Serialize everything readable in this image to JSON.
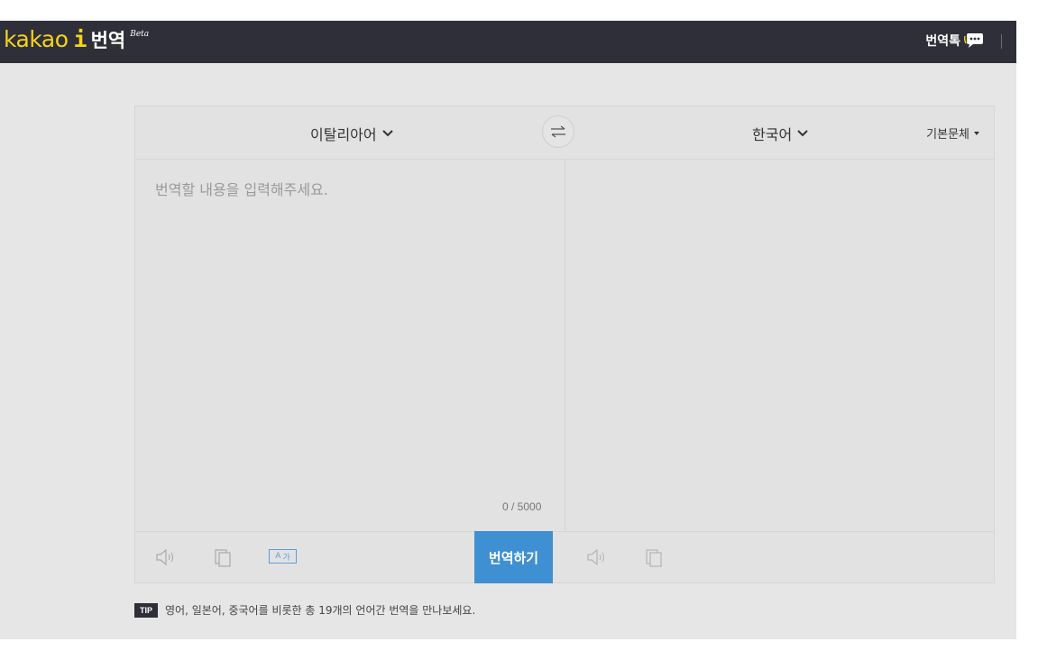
{
  "header": {
    "logo_kakao": "kakao",
    "logo_i": "i",
    "logo_title": "번역",
    "logo_beta": "Beta",
    "talk_link": "번역톡"
  },
  "translator": {
    "source_language": "이탈리아어",
    "target_language": "한국어",
    "font_option": "기본문체",
    "input_placeholder": "번역할 내용을 입력해주세요.",
    "input_value": "",
    "char_count": "0 / 5000",
    "translate_button": "번역하기",
    "ag_icon_label_a": "A",
    "ag_icon_label_ga": "가"
  },
  "tip": {
    "badge": "TIP",
    "text": "영어, 일본어, 중국어를 비롯한 총 19개의 언어간 번역을 만나보세요."
  },
  "colors": {
    "topbar": "#2e2f38",
    "logo_yellow": "#f5d31b",
    "translate_button": "#3f8fd3",
    "panel": "#e2e2e2"
  },
  "icons": {
    "swap": "swap-arrows-icon",
    "speaker": "speaker-icon",
    "copy": "copy-icon",
    "talk": "speech-bubble-icon",
    "font_size": "font-toggle-icon"
  }
}
